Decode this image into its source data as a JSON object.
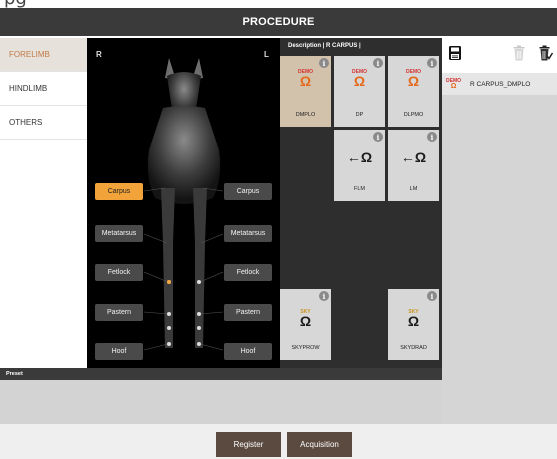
{
  "window": {
    "title_fragment": "pg",
    "header_title": "PROCEDURE"
  },
  "sidebar": {
    "items": [
      {
        "label": "FORELIMB",
        "active": true
      },
      {
        "label": "HINDLIMB",
        "active": false
      },
      {
        "label": "OTHERS",
        "active": false
      }
    ]
  },
  "horse": {
    "right_marker": "R",
    "left_marker": "L",
    "left_parts": [
      "Carpus",
      "Metatarsus",
      "Fetlock",
      "Pastern",
      "Hoof"
    ],
    "right_parts": [
      "Carpus",
      "Metatarsus",
      "Fetlock",
      "Pastern",
      "Hoof"
    ],
    "active_part": "Carpus",
    "active_color": "#f2a33a"
  },
  "procedures": {
    "description": "Description | R CARPUS |",
    "tiles": [
      {
        "tag": "DEMO",
        "label": "DMPLO",
        "selected": true,
        "glyph": "horseshoe-icon"
      },
      {
        "tag": "DEMO",
        "label": "DP",
        "selected": false,
        "glyph": "horseshoe-icon"
      },
      {
        "tag": "DEMO",
        "label": "DLPMO",
        "selected": false,
        "glyph": "horseshoe-icon"
      },
      {
        "tag": "",
        "label": "FLM",
        "selected": false,
        "glyph": "horseshoe-side-icon"
      },
      {
        "tag": "",
        "label": "LM",
        "selected": false,
        "glyph": "horseshoe-side-icon"
      },
      {
        "tag": "SKY",
        "label": "SKYPROW",
        "selected": false,
        "glyph": "horseshoe-icon"
      },
      {
        "tag": "SKY",
        "label": "SKYDRAD",
        "selected": false,
        "glyph": "horseshoe-icon"
      }
    ],
    "info_glyph": "i",
    "horseshoe_glyph": "Ω",
    "side_glyph": "←Ω"
  },
  "selected_list": {
    "items": [
      {
        "tag": "DEMO",
        "name": "R CARPUS_DMPLO"
      }
    ]
  },
  "preset": {
    "label": "Preset"
  },
  "footer": {
    "register_label": "Register",
    "acquisition_label": "Acquisition"
  },
  "colors": {
    "header_bg": "#3a3a3a",
    "sidebar_active": "#c27a45",
    "demo_red": "#d63030",
    "sky_gold": "#c8941c",
    "horseshoe_orange": "#e4691b",
    "button_brown": "#5b4a40",
    "tile_selected": "#d3c2ab"
  }
}
